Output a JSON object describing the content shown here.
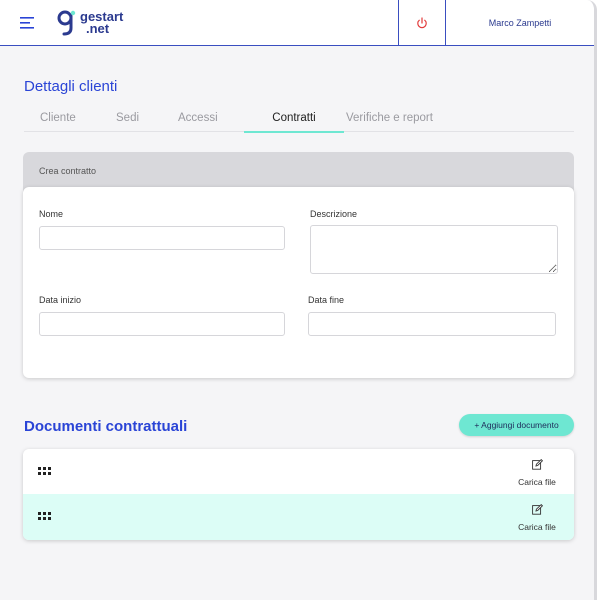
{
  "header": {
    "logo_line1": "gestart",
    "logo_line2": ".net",
    "user_name": "Marco Zampetti"
  },
  "page": {
    "title": "Dettagli clienti"
  },
  "tabs": [
    {
      "label": "Cliente"
    },
    {
      "label": "Sedi"
    },
    {
      "label": "Accessi"
    },
    {
      "label": "Contratti",
      "active": true
    },
    {
      "label": "Verifiche e report"
    }
  ],
  "form": {
    "header": "Crea contratto",
    "nome_label": "Nome",
    "nome_value": "",
    "descrizione_label": "Descrizione",
    "descrizione_value": "",
    "data_inizio_label": "Data inizio",
    "data_inizio_value": "",
    "data_fine_label": "Data fine",
    "data_fine_value": ""
  },
  "documents": {
    "title": "Documenti contrattuali",
    "add_button": "+ Aggiungi documento",
    "rows": [
      {
        "upload_label": "Carica file"
      },
      {
        "upload_label": "Carica file"
      }
    ]
  },
  "colors": {
    "accent": "#2a44d6",
    "mint": "#6ee7d2",
    "power": "#e23b3b"
  },
  "icons": [
    "hamburger-icon",
    "logo-icon",
    "power-icon",
    "drag-handle-icon",
    "edit-icon"
  ]
}
